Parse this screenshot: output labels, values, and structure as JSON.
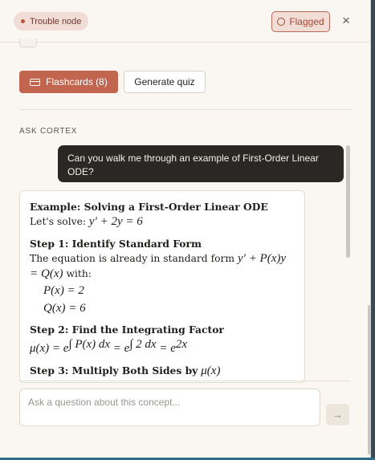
{
  "header": {
    "status_label": "Trouble node",
    "flagged_label": "Flagged",
    "close_glyph": "×"
  },
  "actions": {
    "flashcards_label": "Flashcards (8)",
    "quiz_label": "Generate quiz"
  },
  "chat": {
    "section_label": "ASK CORTEX",
    "user_message": "Can you walk me through an example of First-Order Linear ODE?",
    "answer": {
      "title": "Example: Solving a First-Order Linear ODE",
      "lets_solve": "Let's solve:",
      "equation": "y′ + 2y = 6",
      "step1_heading": "Step 1: Identify Standard Form",
      "step1_text_a": "The equation is already in standard form",
      "step1_form": "y′ + P(x)y =",
      "step1_form2": "Q(x)",
      "step1_text_b": "with:",
      "p_line": "P(x) = 2",
      "q_line": "Q(x) = 6",
      "step2_heading": "Step 2: Find the Integrating Factor",
      "step2_mu": "μ(x) = e",
      "step2_exp1": "∫ P(x) dx",
      "step2_eq": " = e",
      "step2_exp2": "∫ 2 dx",
      "step2_eq2": " = e",
      "step2_exp3": "2x",
      "step3_heading": "Step 3: Multiply Both Sides by",
      "step3_mu": "μ(x)"
    }
  },
  "composer": {
    "placeholder": "Ask a question about this concept...",
    "send_glyph": "→"
  }
}
